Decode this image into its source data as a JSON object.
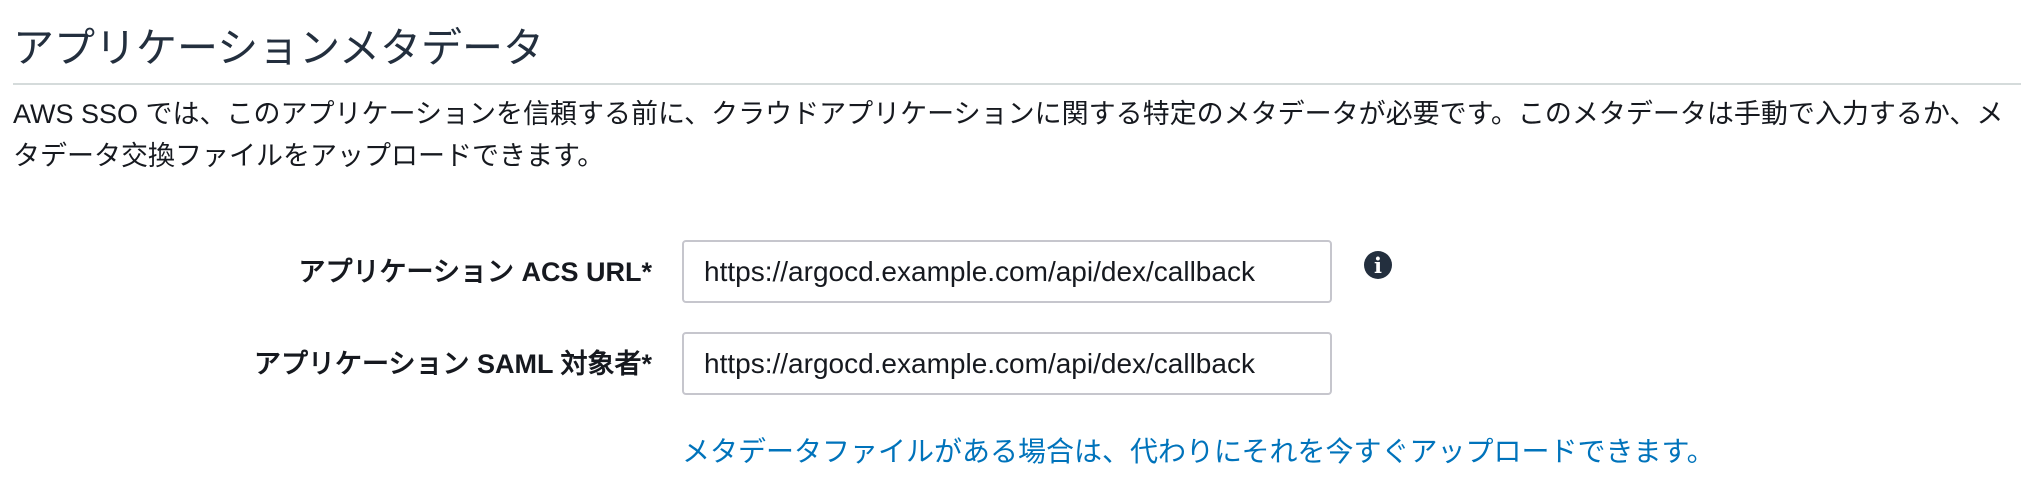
{
  "section": {
    "title": "アプリケーションメタデータ",
    "description": "AWS SSO では、このアプリケーションを信頼する前に、クラウドアプリケーションに関する特定のメタデータが必要です。このメタデータは手動で入力するか、メタデータ交換ファイルをアップロードできます。"
  },
  "form": {
    "acs_url": {
      "label": "アプリケーション ACS URL*",
      "value": "https://argocd.example.com/api/dex/callback",
      "info_icon": "info-icon"
    },
    "saml_audience": {
      "label": "アプリケーション SAML 対象者*",
      "value": "https://argocd.example.com/api/dex/callback"
    }
  },
  "upload_link": {
    "label": "メタデータファイルがある場合は、代わりにそれを今すぐアップロードできます。"
  },
  "colors": {
    "link": "#0073bb",
    "text": "#16191f",
    "border": "#c6c6cd",
    "divider": "#d5dbdb"
  }
}
